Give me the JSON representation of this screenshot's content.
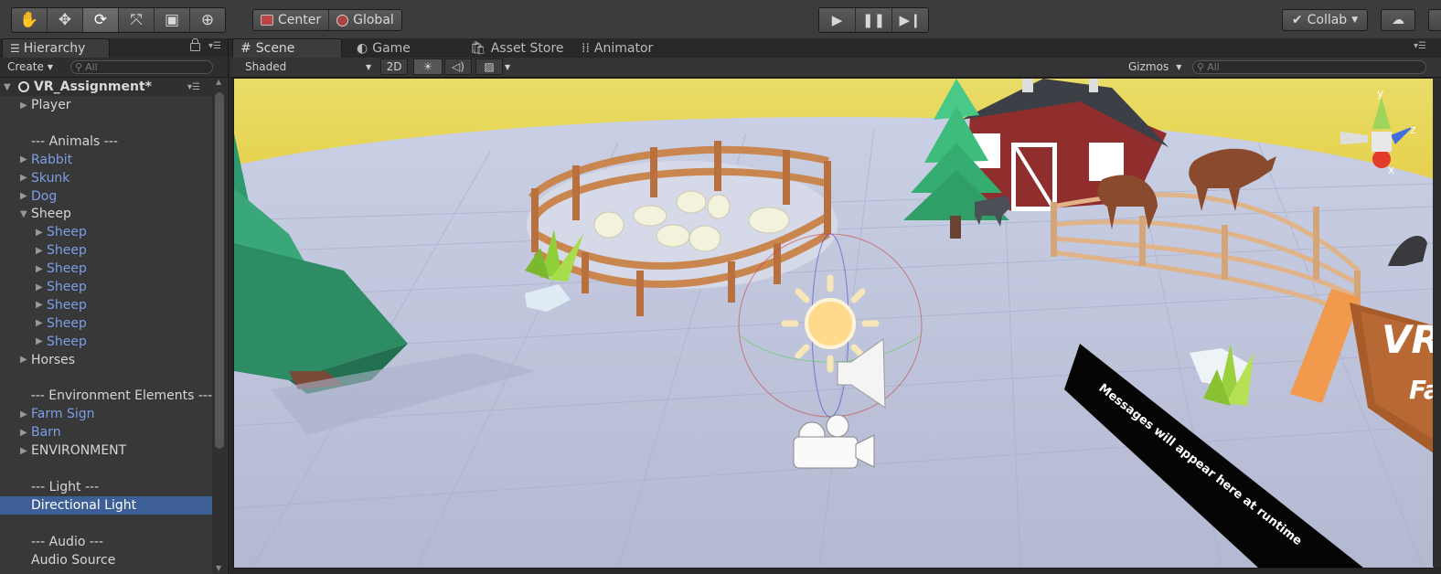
{
  "toolbar": {
    "tools": [
      "hand-tool-icon",
      "move-tool-icon",
      "rotate-tool-icon",
      "scale-tool-icon",
      "rect-tool-icon",
      "transform-tool-icon"
    ],
    "active_tool": "rotate-tool-icon",
    "pivot_label": "Center",
    "space_label": "Global",
    "play_controls": [
      "play-icon",
      "pause-icon",
      "step-icon"
    ],
    "collab_label": "Collab"
  },
  "hierarchy": {
    "tab_label": "Hierarchy",
    "create_label": "Create",
    "search_placeholder": "All",
    "scene_name": "VR_Assignment*",
    "rows": [
      {
        "label": "Player",
        "arrow": "▶",
        "indent": 0,
        "color": "white"
      },
      {
        "label": "",
        "arrow": "",
        "indent": 0,
        "color": "white"
      },
      {
        "label": "--- Animals ---",
        "arrow": "",
        "indent": 0,
        "color": "white"
      },
      {
        "label": "Rabbit",
        "arrow": "▶",
        "indent": 0,
        "color": "blue"
      },
      {
        "label": "Skunk",
        "arrow": "▶",
        "indent": 0,
        "color": "blue"
      },
      {
        "label": "Dog",
        "arrow": "▶",
        "indent": 0,
        "color": "blue"
      },
      {
        "label": "Sheep",
        "arrow": "▼",
        "indent": 0,
        "color": "white"
      },
      {
        "label": "Sheep",
        "arrow": "▶",
        "indent": 1,
        "color": "blue"
      },
      {
        "label": "Sheep",
        "arrow": "▶",
        "indent": 1,
        "color": "blue"
      },
      {
        "label": "Sheep",
        "arrow": "▶",
        "indent": 1,
        "color": "blue"
      },
      {
        "label": "Sheep",
        "arrow": "▶",
        "indent": 1,
        "color": "blue"
      },
      {
        "label": "Sheep",
        "arrow": "▶",
        "indent": 1,
        "color": "blue"
      },
      {
        "label": "Sheep",
        "arrow": "▶",
        "indent": 1,
        "color": "blue"
      },
      {
        "label": "Sheep",
        "arrow": "▶",
        "indent": 1,
        "color": "blue"
      },
      {
        "label": "Horses",
        "arrow": "▶",
        "indent": 0,
        "color": "white"
      },
      {
        "label": "",
        "arrow": "",
        "indent": 0,
        "color": "white"
      },
      {
        "label": "--- Environment Elements ---",
        "arrow": "",
        "indent": 0,
        "color": "white"
      },
      {
        "label": "Farm Sign",
        "arrow": "▶",
        "indent": 0,
        "color": "blue"
      },
      {
        "label": "Barn",
        "arrow": "▶",
        "indent": 0,
        "color": "blue"
      },
      {
        "label": "ENVIRONMENT",
        "arrow": "▶",
        "indent": 0,
        "color": "white"
      },
      {
        "label": "",
        "arrow": "",
        "indent": 0,
        "color": "white"
      },
      {
        "label": "--- Light ---",
        "arrow": "",
        "indent": 0,
        "color": "white"
      },
      {
        "label": "Directional Light",
        "arrow": "",
        "indent": 0,
        "color": "white",
        "selected": true
      },
      {
        "label": "",
        "arrow": "",
        "indent": 0,
        "color": "white"
      },
      {
        "label": "--- Audio ---",
        "arrow": "",
        "indent": 0,
        "color": "white"
      },
      {
        "label": "Audio Source",
        "arrow": "",
        "indent": 0,
        "color": "white"
      }
    ]
  },
  "scene_view": {
    "tabs": {
      "scene": "Scene",
      "game": "Game",
      "asset_store": "Asset Store",
      "animator": "Animator"
    },
    "shading_mode": "Shaded",
    "mode_2d": "2D",
    "gizmos_label": "Gizmos",
    "search_placeholder": "All",
    "axis_labels": {
      "y": "y",
      "z": "z",
      "x": "x"
    },
    "sign_text": "VR",
    "sign_text_2": "Fa",
    "message_board_text": "Messages will appear here at runtime"
  }
}
